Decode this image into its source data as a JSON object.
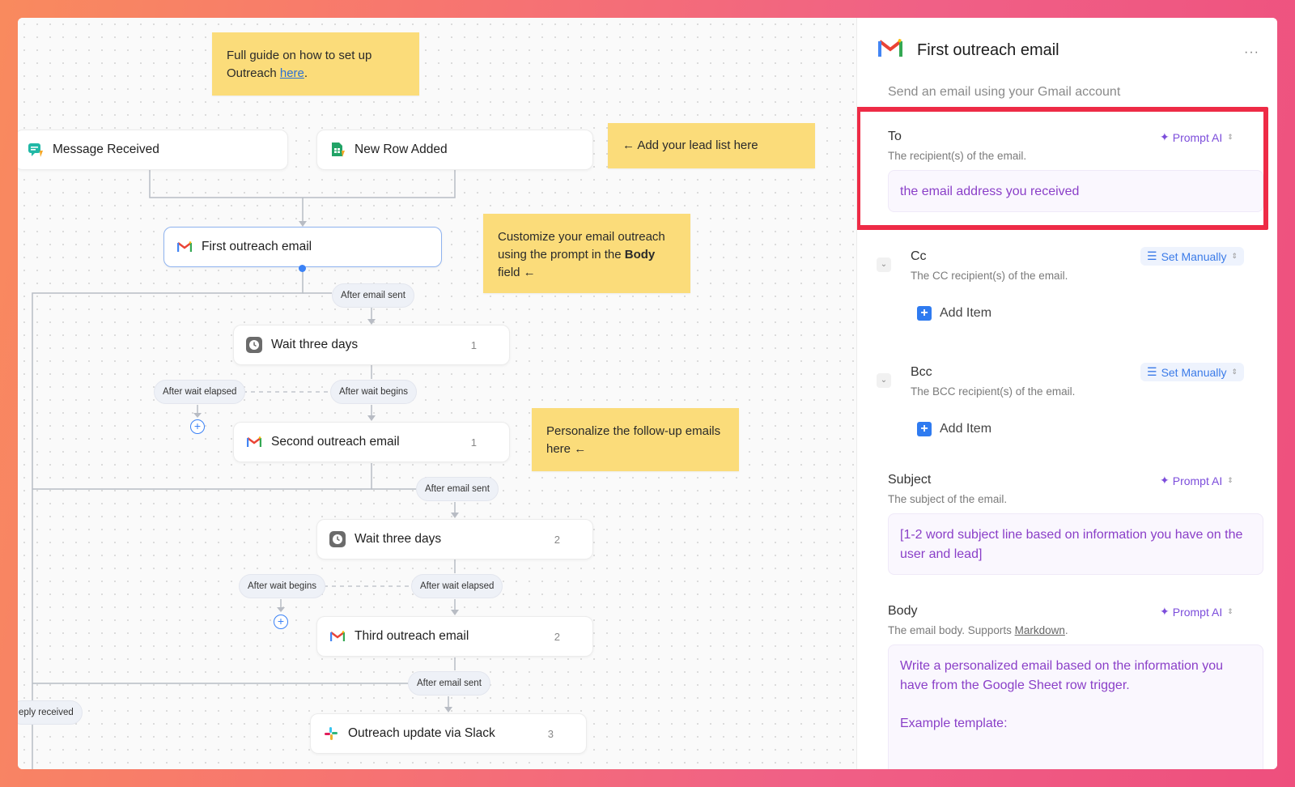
{
  "canvas": {
    "sticky_guide": {
      "text": "Full guide on how to set up Outreach ",
      "link": "here",
      "after": "."
    },
    "sticky_lead": "← Add your lead list here",
    "sticky_customize": {
      "before": "Customize your email outreach using the prompt in the ",
      "bold": "Body",
      "after": " field ←"
    },
    "sticky_personalize": "Personalize the follow-up emails here ←",
    "nodes": {
      "message_received": "Message Received",
      "new_row_added": "New Row Added",
      "first_email": "First outreach email",
      "wait1": {
        "label": "Wait three days",
        "count": "1"
      },
      "second_email": {
        "label": "Second outreach email",
        "count": "1"
      },
      "wait2": {
        "label": "Wait three days",
        "count": "2"
      },
      "third_email": {
        "label": "Third outreach email",
        "count": "2"
      },
      "slack": {
        "label": "Outreach update via Slack",
        "count": "3"
      }
    },
    "pills": {
      "after_sent_1": "After email sent",
      "after_wait_elapsed_1": "After wait elapsed",
      "after_wait_begins_1": "After wait begins",
      "after_sent_2": "After email sent",
      "after_wait_begins_2": "After wait begins",
      "after_wait_elapsed_2": "After wait elapsed",
      "after_sent_3": "After email sent",
      "reply_received": "eply received"
    }
  },
  "panel": {
    "title": "First outreach email",
    "more": "···",
    "subtitle": "Send an email using your Gmail account",
    "to": {
      "label": "To",
      "desc": "The recipient(s) of the email.",
      "mode": "Prompt AI",
      "value": "the email address you received"
    },
    "cc": {
      "label": "Cc",
      "desc": "The CC recipient(s) of the email.",
      "mode": "Set Manually",
      "add": "Add Item"
    },
    "bcc": {
      "label": "Bcc",
      "desc": "The BCC recipient(s) of the email.",
      "mode": "Set Manually",
      "add": "Add Item"
    },
    "subject": {
      "label": "Subject",
      "desc": "The subject of the email.",
      "mode": "Prompt AI",
      "value": "[1-2 word subject line based on information you have on the user and lead]"
    },
    "body": {
      "label": "Body",
      "desc_before": "The email body. Supports ",
      "desc_link": "Markdown",
      "desc_after": ".",
      "mode": "Prompt AI",
      "value_line1": "Write a personalized email based on the information you have from the Google Sheet row trigger.",
      "value_line2": "Example template:"
    }
  },
  "colors": {
    "accent_purple": "#8a3fc8",
    "accent_blue": "#3b7be8",
    "highlight_red": "#ee2b46",
    "sticky_yellow": "#fbdc7a"
  }
}
